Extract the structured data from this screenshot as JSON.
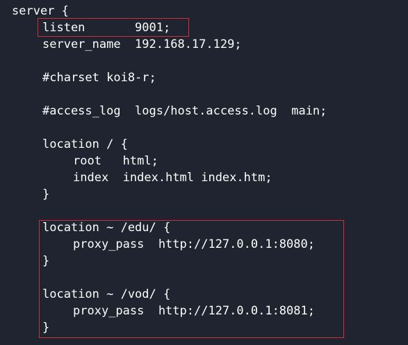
{
  "code": {
    "lines": [
      "server {",
      "listen       9001;",
      "server_name  192.168.17.129;",
      "",
      "#charset koi8-r;",
      "",
      "#access_log  logs/host.access.log  main;",
      "",
      "location / {",
      "root   html;",
      "index  index.html index.htm;",
      "}",
      "",
      "location ~ /edu/ {",
      "proxy_pass  http://127.0.0.1:8080;",
      "}",
      "",
      "location ~ /vod/ {",
      "proxy_pass  http://127.0.0.1:8081;",
      "}"
    ]
  },
  "colors": {
    "background": "#1f2430",
    "text": "#ffffff",
    "highlight": "#c9323b"
  }
}
